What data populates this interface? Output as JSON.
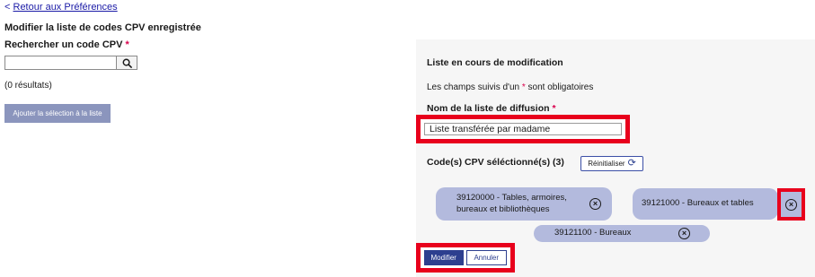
{
  "back_link": {
    "chevron": "<",
    "label": "Retour aux Préférences"
  },
  "left": {
    "title": "Modifier la liste de codes CPV enregistrée",
    "search_label": "Rechercher un code CPV",
    "required_mark": "*",
    "search_value": "",
    "search_icon": "search-icon",
    "results": "(0 résultats)",
    "add_button": "Ajouter la sélection à la liste"
  },
  "panel": {
    "title": "Liste en cours de modification",
    "note_before": "Les champs suivis d'un",
    "note_mark": "*",
    "note_after": "sont obligatoires",
    "list_name_label": "Nom de la liste de diffusion",
    "list_name_value": "Liste transférée par madame",
    "codes_label": "Code(s) CPV séléctionné(s) (3)",
    "reset_button": "Réinitialiser",
    "reset_icon": "refresh-icon",
    "chips": [
      {
        "line1": "39120000 - Tables, armoires,",
        "line2": "bureaux et bibliothèques"
      },
      {
        "line1": "39121000 - Bureaux et tables"
      },
      {
        "line1": "39121100 - Bureaux"
      }
    ],
    "remove_icon": "close-circle-icon",
    "remove_glyph": "×",
    "modify_button": "Modifier",
    "cancel_button": "Annuler"
  },
  "colors": {
    "highlight": "#e8001c",
    "primary": "#2d3f8f",
    "chip": "#b3badd",
    "required": "#d9004c"
  }
}
